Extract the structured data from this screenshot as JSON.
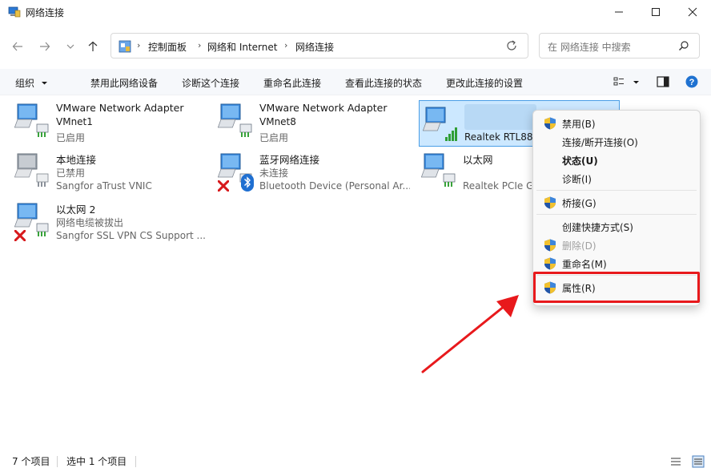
{
  "window": {
    "title": "网络连接",
    "minimize_icon": "minimize-icon",
    "maximize_icon": "maximize-icon",
    "close_icon": "close-icon"
  },
  "nav": {
    "breadcrumbs": [
      "控制面板",
      "网络和 Internet",
      "网络连接"
    ],
    "search_placeholder": "在 网络连接 中搜索"
  },
  "toolbar": {
    "organize": "组织",
    "disable": "禁用此网络设备",
    "diagnose": "诊断这个连接",
    "rename": "重命名此连接",
    "view_status": "查看此连接的状态",
    "change_settings": "更改此连接的设置"
  },
  "items": [
    {
      "name": "VMware Network Adapter",
      "line2": "VMnet1",
      "line3": "已启用"
    },
    {
      "name": "VMware Network Adapter",
      "line2": "VMnet8",
      "line3": "已启用"
    },
    {
      "name": "",
      "line2": "",
      "line3": "Realtek RTL885"
    },
    {
      "name": "本地连接",
      "line2": "已禁用",
      "line3": "Sangfor aTrust VNIC"
    },
    {
      "name": "蓝牙网络连接",
      "line2": "未连接",
      "line3": "Bluetooth Device (Personal Ar..."
    },
    {
      "name": "以太网",
      "line2": "",
      "line3": "Realtek PCIe G"
    },
    {
      "name": "以太网 2",
      "line2": "网络电缆被拔出",
      "line3": "Sangfor SSL VPN CS Support ..."
    }
  ],
  "context_menu": {
    "disable": "禁用(B)",
    "connect": "连接/断开连接(O)",
    "status": "状态(U)",
    "diagnose": "诊断(I)",
    "bridge": "桥接(G)",
    "shortcut": "创建快捷方式(S)",
    "delete": "删除(D)",
    "rename": "重命名(M)",
    "properties": "属性(R)"
  },
  "status": {
    "count": "7 个项目",
    "selected": "选中 1 个项目"
  },
  "colors": {
    "accent": "#0067c0",
    "selection_bg": "#cce8ff",
    "highlight_red": "#e8191c"
  }
}
